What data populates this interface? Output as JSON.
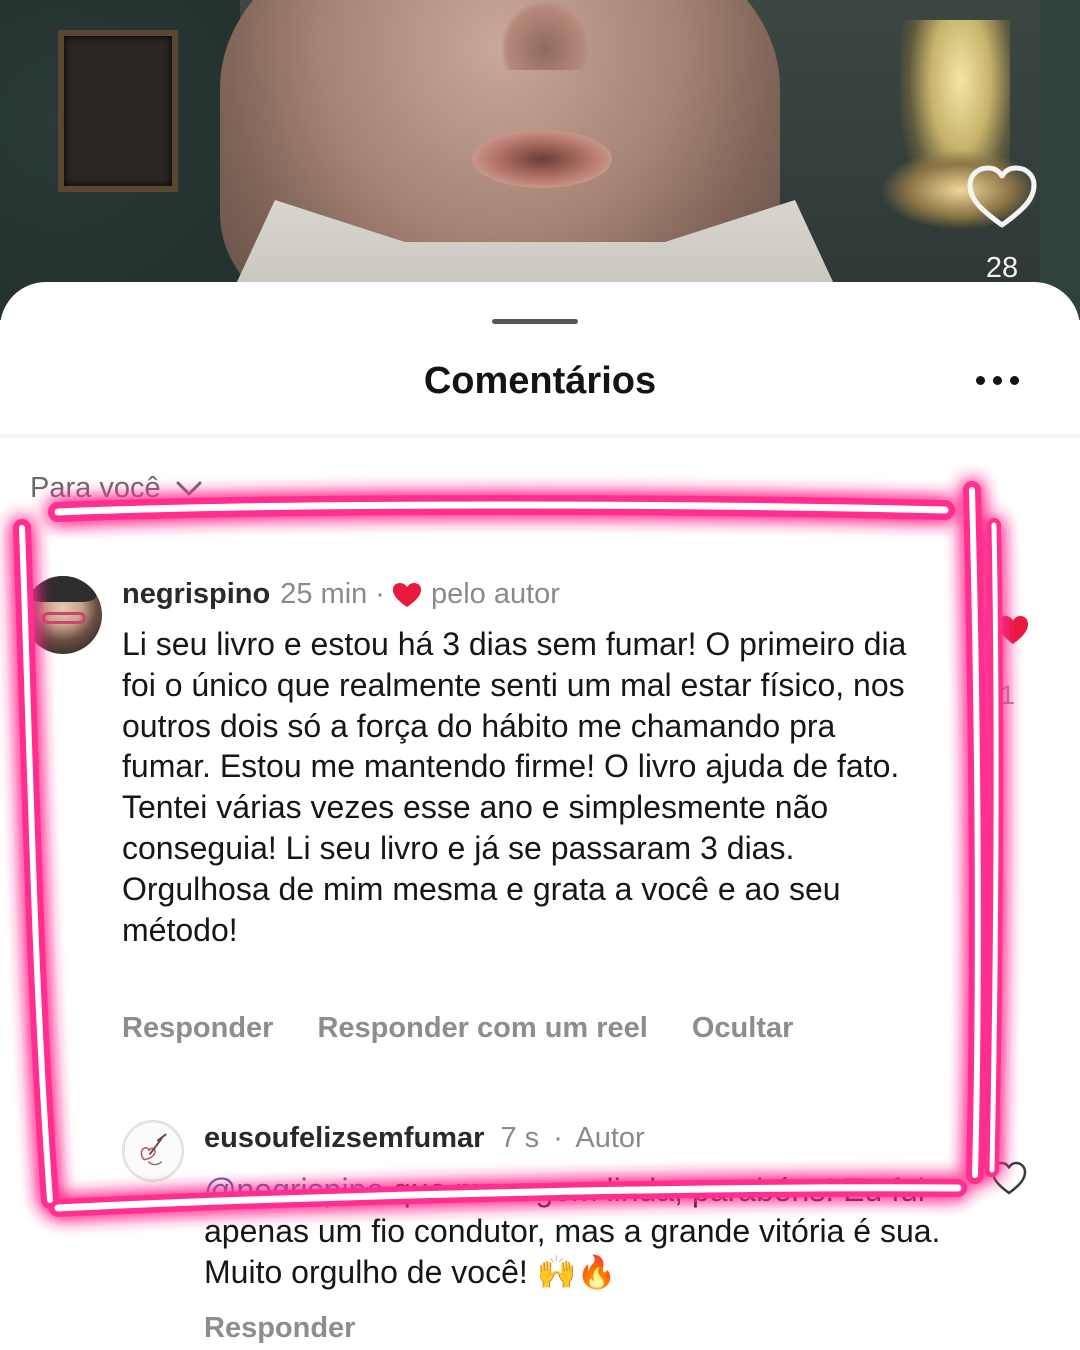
{
  "video": {
    "like_count": "28",
    "icons": {
      "like": "heart-outline-icon"
    }
  },
  "sheet": {
    "title": "Comentários",
    "more_icon": "more-horizontal-icon",
    "filter_label": "Para você",
    "filter_icon": "chevron-down-icon"
  },
  "comments": [
    {
      "username": "negrispino",
      "time": "25 min",
      "separator": "·",
      "liked_by_author_label": "pelo autor",
      "text": "Li seu livro e estou há 3 dias sem fumar! O primeiro dia foi o único que realmente senti um mal estar físico, nos outros dois só a força do hábito me chamando pra fumar. Estou me mantendo firme! O livro ajuda de fato. Tentei várias vezes esse ano e simplesmente não conseguia! Li seu livro e já se passaram 3 dias. Orgulhosa de mim mesma e grata a você e ao seu método!",
      "actions": [
        "Responder",
        "Responder com um reel",
        "Ocultar"
      ],
      "like_count": "1",
      "like_color": "#e8193c"
    }
  ],
  "reply": {
    "username": "eusoufelizsemfumar",
    "time": "7 s",
    "separator": "·",
    "badge": "Autor",
    "mention": "@negrispino",
    "text": " que menagem linda, parabéns! Eu fui apenas um fio condutor, mas a grande vitória é sua. Muito orgulho de você! 🙌🔥",
    "action": "Responder"
  },
  "colors": {
    "highlight": "#ff2f8f",
    "mention": "#4a5fa6"
  }
}
